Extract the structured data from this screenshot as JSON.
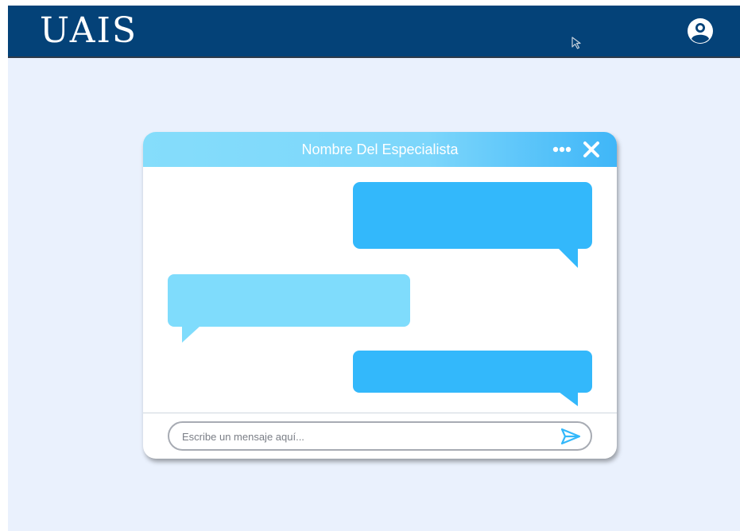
{
  "header": {
    "logo_text": "UAIS",
    "profile_icon": "user-circle-icon"
  },
  "chat": {
    "title": "Nombre Del Especialista",
    "more_icon": "more-horizontal-icon",
    "close_icon": "close-icon",
    "messages": [
      {
        "side": "sent",
        "text": ""
      },
      {
        "side": "received",
        "text": ""
      },
      {
        "side": "sent",
        "text": ""
      }
    ],
    "input": {
      "value": "",
      "placeholder": "Escribe un mensaje aquí..."
    },
    "send_icon": "send-icon"
  },
  "colors": {
    "header_bg": "#044278",
    "page_bg": "#eaf1fd",
    "sent_bubble": "#33b8fb",
    "received_bubble": "#7fdcfc",
    "chat_header_start": "#85ddfb",
    "chat_header_end": "#3fb6f8"
  }
}
